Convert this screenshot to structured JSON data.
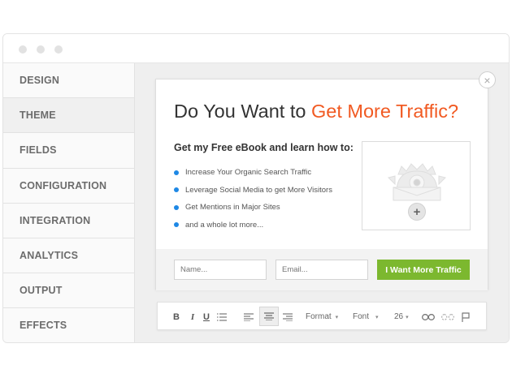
{
  "sidebar": {
    "items": [
      {
        "label": "DESIGN"
      },
      {
        "label": "THEME"
      },
      {
        "label": "FIELDS"
      },
      {
        "label": "CONFIGURATION"
      },
      {
        "label": "INTEGRATION"
      },
      {
        "label": "ANALYTICS"
      },
      {
        "label": "OUTPUT"
      },
      {
        "label": "EFFECTS"
      }
    ],
    "active_label": "THEME"
  },
  "popup": {
    "title_prefix": "Do You Want to ",
    "title_highlight": "Get More Traffic?",
    "subhead": "Get my Free eBook and learn how to:",
    "bullets": [
      "Increase Your Organic Search Traffic",
      "Leverage Social Media to get More Visitors",
      "Get Mentions in Major Sites",
      "and a whole lot more..."
    ],
    "add_image_symbol": "+",
    "close_symbol": "×",
    "form": {
      "name_placeholder": "Name...",
      "email_placeholder": "Email...",
      "submit_label": "I Want More Traffic"
    }
  },
  "toolbar": {
    "bold": "B",
    "italic": "I",
    "underline": "U",
    "format_label": "Format",
    "font_label": "Font",
    "size_value": "26",
    "icons": [
      "list-icon",
      "align-left-icon",
      "align-center-icon",
      "align-right-icon",
      "link-icon",
      "unlink-icon",
      "flag-icon"
    ]
  },
  "colors": {
    "accent": "#f15a22",
    "submit": "#7cb82f",
    "bullet": "#1e88e5"
  }
}
